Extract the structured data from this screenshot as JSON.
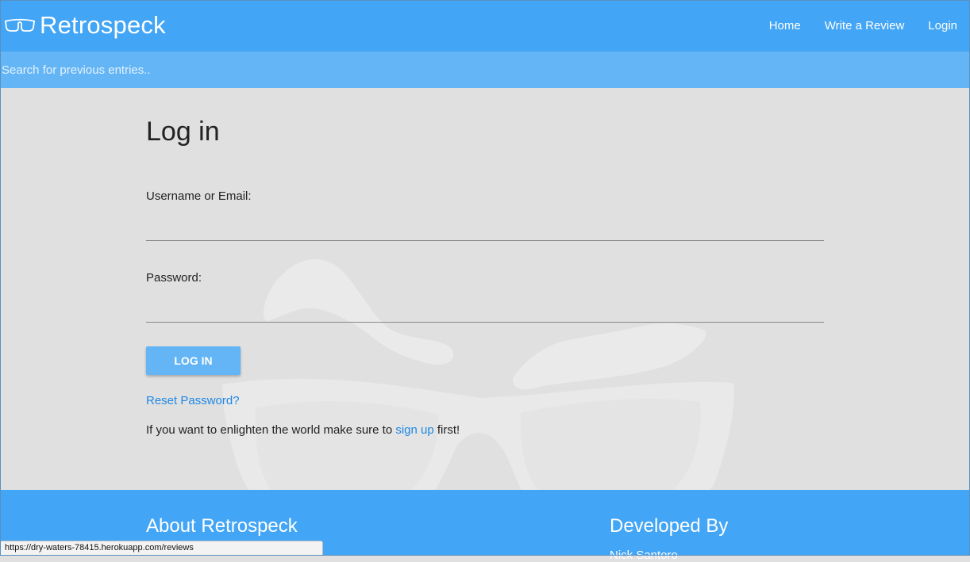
{
  "nav": {
    "brand": "Retrospeck",
    "links": [
      "Home",
      "Write a Review",
      "Login"
    ]
  },
  "search": {
    "placeholder": "Search for previous entries..",
    "value": ""
  },
  "login": {
    "title": "Log in",
    "username_label": "Username or Email:",
    "username_value": "",
    "password_label": "Password:",
    "password_value": "",
    "button": "LOG IN",
    "reset_link": "Reset Password?",
    "signup_prefix": "If you want to enlighten the world make sure to ",
    "signup_link": "sign up",
    "signup_suffix": " first!"
  },
  "footer": {
    "about_heading": "About Retrospeck",
    "developed_heading": "Developed By",
    "developer_name": "Nick Santoro"
  },
  "status_bar": {
    "url": "https://dry-waters-78415.herokuapp.com/reviews"
  },
  "colors": {
    "primary": "#42a5f5",
    "search_bar": "#64b5f6",
    "button": "#64b5f6",
    "link": "#1e88e5",
    "background": "#e0e0e0"
  },
  "icons": [
    "glasses-logo-icon"
  ]
}
